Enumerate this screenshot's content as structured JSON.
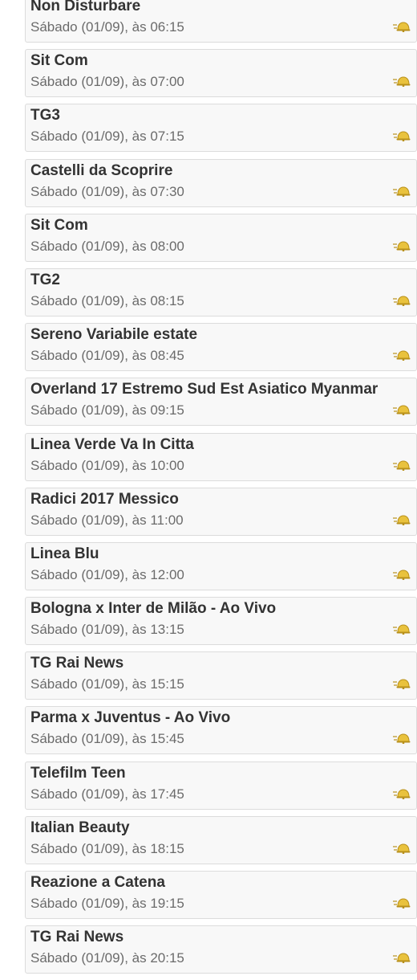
{
  "schedule": {
    "items": [
      {
        "title": "Non Disturbare",
        "time": "Sábado (01/09), às 06:15",
        "icon": "reminder-bell-icon"
      },
      {
        "title": "Sit Com",
        "time": "Sábado (01/09), às 07:00",
        "icon": "reminder-bell-icon"
      },
      {
        "title": "TG3",
        "time": "Sábado (01/09), às 07:15",
        "icon": "reminder-bell-icon"
      },
      {
        "title": "Castelli da Scoprire",
        "time": "Sábado (01/09), às 07:30",
        "icon": "reminder-bell-icon"
      },
      {
        "title": "Sit Com",
        "time": "Sábado (01/09), às 08:00",
        "icon": "reminder-bell-icon"
      },
      {
        "title": "TG2",
        "time": "Sábado (01/09), às 08:15",
        "icon": "reminder-bell-icon"
      },
      {
        "title": "Sereno Variabile estate",
        "time": "Sábado (01/09), às 08:45",
        "icon": "reminder-bell-icon"
      },
      {
        "title": "Overland 17 Estremo Sud Est Asiatico Myanmar",
        "time": "Sábado (01/09), às 09:15",
        "icon": "reminder-bell-icon"
      },
      {
        "title": "Linea Verde Va In Citta",
        "time": "Sábado (01/09), às 10:00",
        "icon": "reminder-bell-icon"
      },
      {
        "title": "Radici 2017 Messico",
        "time": "Sábado (01/09), às 11:00",
        "icon": "reminder-bell-icon"
      },
      {
        "title": "Linea Blu",
        "time": "Sábado (01/09), às 12:00",
        "icon": "reminder-bell-icon"
      },
      {
        "title": "Bologna x Inter de Milão - Ao Vivo",
        "time": "Sábado (01/09), às 13:15",
        "icon": "reminder-bell-icon"
      },
      {
        "title": "TG Rai News",
        "time": "Sábado (01/09), às 15:15",
        "icon": "reminder-bell-icon"
      },
      {
        "title": "Parma x Juventus - Ao Vivo",
        "time": "Sábado (01/09), às 15:45",
        "icon": "reminder-bell-icon"
      },
      {
        "title": "Telefilm Teen",
        "time": "Sábado (01/09), às 17:45",
        "icon": "reminder-bell-icon"
      },
      {
        "title": "Italian Beauty",
        "time": "Sábado (01/09), às 18:15",
        "icon": "reminder-bell-icon"
      },
      {
        "title": "Reazione a Catena",
        "time": "Sábado (01/09), às 19:15",
        "icon": "reminder-bell-icon"
      },
      {
        "title": "TG Rai News",
        "time": "Sábado (01/09), às 20:15",
        "icon": "reminder-bell-icon"
      }
    ]
  },
  "colors": {
    "bell_fill": "#e9c23d",
    "bell_outline": "#b8901b",
    "card_background": "#f8f8f8",
    "card_border": "#dcdcdc",
    "title_text": "#333333",
    "time_text": "#6b6b6b"
  }
}
